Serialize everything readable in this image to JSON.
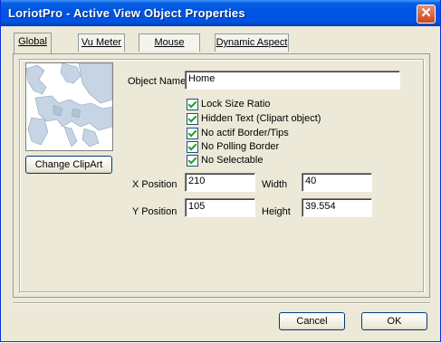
{
  "window": {
    "title": "LoriotPro - Active View Object Properties"
  },
  "tabs": [
    {
      "label": "Global"
    },
    {
      "label": "Vu Meter"
    },
    {
      "label": "Mouse Action"
    },
    {
      "label": "Dynamic Aspect"
    }
  ],
  "object": {
    "name_label": "Object Name",
    "name_value": "Home"
  },
  "clipart": {
    "button_label": "Change ClipArt",
    "image": "europe-map"
  },
  "options": [
    {
      "label": "Lock Size Ratio",
      "checked": true
    },
    {
      "label": "Hidden Text (Clipart object)",
      "checked": true
    },
    {
      "label": "No actif Border/Tips",
      "checked": true
    },
    {
      "label": "No Polling Border",
      "checked": true
    },
    {
      "label": "No Selectable",
      "checked": true
    }
  ],
  "position": {
    "x_label": "X Position",
    "x_value": "210",
    "y_label": "Y Position",
    "y_value": "105",
    "width_label": "Width",
    "width_value": "40",
    "height_label": "Height",
    "height_value": "39.554"
  },
  "buttons": {
    "cancel": "Cancel",
    "ok": "OK"
  },
  "colors": {
    "titlebar": "#0054e3",
    "dialog_bg": "#ece9d8",
    "check_mark": "#21a121",
    "close": "#c9451d"
  }
}
